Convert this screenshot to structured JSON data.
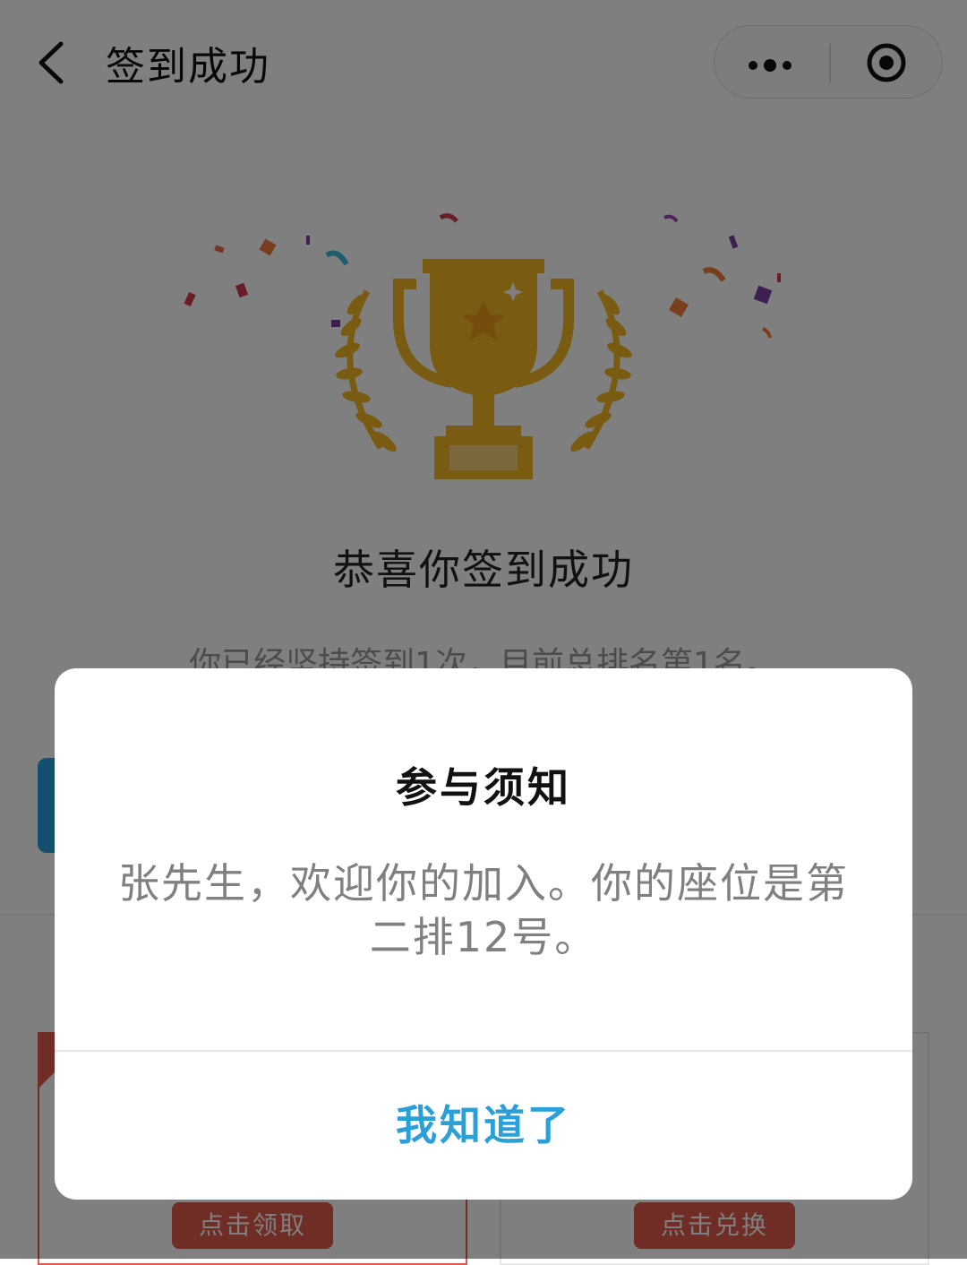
{
  "nav": {
    "title": "签到成功"
  },
  "main": {
    "congrats_title": "恭喜你签到成功",
    "streak_text": "你已经坚持签到1次，目前总排名第1名。",
    "cards": [
      {
        "button_label": "点击领取"
      },
      {
        "button_label": "点击兑换"
      }
    ]
  },
  "modal": {
    "title": "参与须知",
    "content": "张先生，欢迎你的加入。你的座位是第二排12号。",
    "confirm_label": "我知道了"
  },
  "colors": {
    "accent": "#2a9fd8",
    "trophy_gold": "#f2b925",
    "card_button": "#e05b4a"
  }
}
